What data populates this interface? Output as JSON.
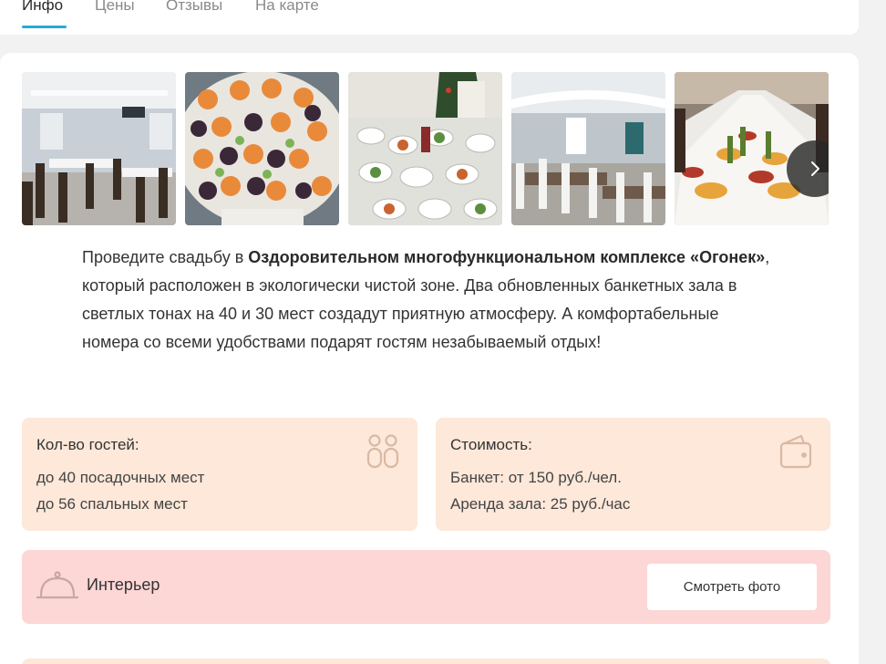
{
  "tabs": [
    {
      "label": "Инфо",
      "active": true
    },
    {
      "label": "Цены",
      "active": false
    },
    {
      "label": "Отзывы",
      "active": false
    },
    {
      "label": "На карте",
      "active": false
    }
  ],
  "gallery": {
    "photos": [
      "banquet-hall-photo",
      "caviar-appetizers-photo",
      "festive-table-photo",
      "dining-hall-photo",
      "long-banquet-table-photo"
    ],
    "next_icon": "chevron-right-icon"
  },
  "description": {
    "p1": "Проведите свадьбу в ",
    "bold": "Оздоровительном многофункциональном комплексе «Огонек»",
    "p2": ", который расположен в экологически чистой зоне. Два обновленных банкетных зала в светлых тонах на 40 и 30 мест создадут приятную атмосферу. А комфортабельные номера со всеми удобствами подарят гостям незабываемый отдых!"
  },
  "guests": {
    "title": "Кол-во гостей:",
    "lines": [
      "до 40 посадочных мест",
      "до 56 спальных мест"
    ],
    "icon": "guests-icon"
  },
  "price": {
    "title": "Стоимость:",
    "lines": [
      "Банкет: от 150 руб./чел.",
      "Аренда зала: 25 руб./час"
    ],
    "icon": "wallet-icon"
  },
  "interior": {
    "label": "Интерьер",
    "button": "Смотреть фото",
    "icon": "cloche-icon"
  },
  "colors": {
    "accent": "#29a9d9",
    "info_bg": "#fde8d9",
    "interior_bg": "#fdd6d6"
  }
}
